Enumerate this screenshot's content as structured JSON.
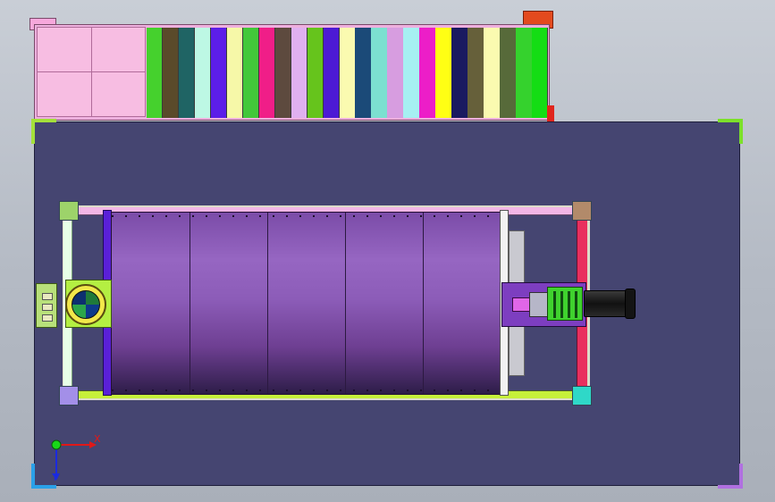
{
  "viewport": {
    "name": "CAD top view",
    "background": "#c2c7d0"
  },
  "rack": {
    "slot_colors": [
      "#45d12d",
      "#5a4a2a",
      "#1f6464",
      "#bdf8e4",
      "#5c1ee8",
      "#f6f8a8",
      "#42c83a",
      "#f01e88",
      "#5d4a3e",
      "#e0b0f0",
      "#66c41c",
      "#4c1ad4",
      "#fafab0",
      "#1b4a78",
      "#7ce0d0",
      "#d79de0",
      "#a6f0f2",
      "#ec1ec8",
      "#ffff14",
      "#1a1a60",
      "#66603a",
      "#fafab0",
      "#576a3a",
      "#35d22d",
      "#14dd14"
    ]
  },
  "triad": {
    "x_label": "X",
    "y_label": "Y"
  },
  "colors": {
    "base_plate": "#454571",
    "drum": "#8c5cb8",
    "frame": "#dcdcc9",
    "accent_red": "#e0251d"
  }
}
